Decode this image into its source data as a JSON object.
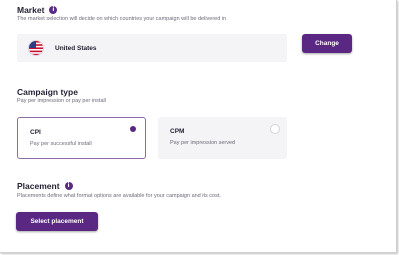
{
  "market": {
    "title": "Market",
    "description": "The market selection will decide on which countries your campaign will be delivered in",
    "selected_country": "United States",
    "change_label": "Change"
  },
  "campaign_type": {
    "title": "Campaign type",
    "description": "Pay per impression or pay per install",
    "options": [
      {
        "label": "CPI",
        "description": "Pay per successful install",
        "selected": true
      },
      {
        "label": "CPM",
        "description": "Pay per impression served",
        "selected": false
      }
    ]
  },
  "placement": {
    "title": "Placement",
    "description": "Placements define what format options are available for your campaign and its cost.",
    "button_label": "Select placement"
  },
  "colors": {
    "accent": "#5a2883",
    "card_background": "#f4f3f6",
    "selected_border": "#8b6aa8"
  },
  "icons": {
    "info": "info-icon",
    "flag": "us-flag-icon"
  }
}
